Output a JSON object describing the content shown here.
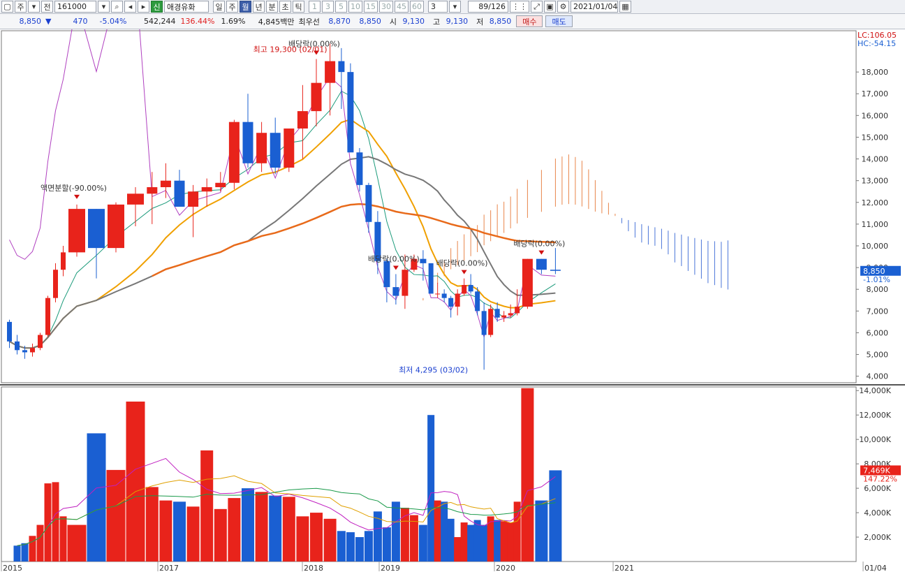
{
  "toolbar": {
    "market_label": "주",
    "prev_label": "전",
    "code": "161000",
    "new_badge": "신",
    "stock_name": "애경유화",
    "period_tabs": [
      "일",
      "주",
      "월",
      "년",
      "분",
      "초",
      "틱"
    ],
    "selected_period": "월",
    "minute_options": [
      "1",
      "3",
      "5",
      "10",
      "15",
      "30",
      "45",
      "60"
    ],
    "interval_value": "3",
    "page_counter": "89/126",
    "date_value": "2021/01/04"
  },
  "quote": {
    "price": "8,850",
    "change_arrow": "▼",
    "change": "470",
    "change_rate": "-5.04%",
    "volume": "542,244",
    "volume_ratio": "136.44%",
    "turnover": "1.69%",
    "amount": "4,845백만",
    "best_label": "최우선",
    "best_ask": "8,870",
    "best_bid": "8,850",
    "open_label": "시",
    "open": "9,130",
    "high_label": "고",
    "high": "9,130",
    "low_label": "저",
    "low": "8,850",
    "buy_label": "매수",
    "sell_label": "매도"
  },
  "colors": {
    "up": "#e8231b",
    "down": "#1a5fd2",
    "accent": "#3c5ea8"
  },
  "chart_data": [
    {
      "type": "candlestick",
      "title": "",
      "xlabel": "",
      "ylabel": "",
      "ylim": [
        3700,
        19900
      ],
      "y_ticks": [
        "4,000",
        "5,000",
        "6,000",
        "7,000",
        "8,000",
        "9,000",
        "10,000",
        "11,000",
        "12,000",
        "13,000",
        "14,000",
        "15,000",
        "16,000",
        "17,000",
        "18,000"
      ],
      "x_ticks": [
        "2015",
        "2017",
        "2018",
        "2019",
        "2020",
        "2021",
        "01/04"
      ],
      "indicator_corner": [
        "LC:106.05",
        "HC:-54.15"
      ],
      "price_tag": "8,850",
      "price_tag_value": 8850,
      "price_tag_change": "-1.01%",
      "annotations": {
        "high_label": "최고 19,300 (02/01)",
        "low_label": "최저 4,295 (03/02)",
        "split_label": "액면분할(-90.00%)",
        "dividend_label": "배당락(0.00%)"
      },
      "candles": [
        [
          6500,
          6600,
          5300,
          5600
        ],
        [
          5600,
          5900,
          5000,
          5200
        ],
        [
          5200,
          5400,
          4800,
          5100
        ],
        [
          5100,
          5500,
          4900,
          5300
        ],
        [
          5300,
          6000,
          5200,
          5900
        ],
        [
          5900,
          7700,
          5800,
          7600
        ],
        [
          7600,
          9200,
          7400,
          8900
        ],
        [
          8900,
          10000,
          8600,
          9700
        ],
        [
          9700,
          11900,
          9500,
          11700
        ],
        [
          11700,
          11700,
          8500,
          9900
        ],
        [
          9900,
          12000,
          9700,
          11900
        ],
        [
          11900,
          12700,
          10900,
          12400
        ],
        [
          12400,
          13400,
          11000,
          12700
        ],
        [
          12700,
          13800,
          12200,
          13000
        ],
        [
          13000,
          13500,
          12100,
          11800
        ],
        [
          11800,
          12800,
          10400,
          12500
        ],
        [
          12500,
          13100,
          11800,
          12700
        ],
        [
          12700,
          13400,
          12500,
          12900
        ],
        [
          12900,
          15800,
          12600,
          15700
        ],
        [
          15700,
          17000,
          13600,
          13800
        ],
        [
          13800,
          15700,
          13400,
          15200
        ],
        [
          15200,
          15900,
          13300,
          13600
        ],
        [
          13600,
          15400,
          13400,
          15400
        ],
        [
          15400,
          17400,
          14000,
          16200
        ],
        [
          16200,
          18600,
          15500,
          17500
        ],
        [
          17500,
          19300,
          16000,
          18500
        ],
        [
          18500,
          19100,
          16300,
          18000
        ],
        [
          18000,
          18400,
          15000,
          14300
        ],
        [
          14300,
          14500,
          12500,
          12800
        ],
        [
          12800,
          12900,
          10600,
          11100
        ],
        [
          11100,
          11600,
          8700,
          9300
        ],
        [
          9300,
          9400,
          7400,
          8100
        ],
        [
          8100,
          8700,
          7300,
          7700
        ],
        [
          7700,
          9600,
          7100,
          8900
        ],
        [
          8900,
          9600,
          8800,
          9400
        ],
        [
          9400,
          9800,
          8400,
          9200
        ],
        [
          9200,
          9200,
          7800,
          7800
        ],
        [
          7800,
          8300,
          7600,
          7800
        ],
        [
          7800,
          8000,
          7400,
          7600
        ],
        [
          7600,
          7700,
          6700,
          7200
        ],
        [
          7200,
          8000,
          6800,
          7800
        ],
        [
          7800,
          8500,
          7700,
          8200
        ],
        [
          8200,
          8700,
          7800,
          7900
        ],
        [
          7900,
          8100,
          6800,
          7000
        ],
        [
          7000,
          7400,
          4300,
          5900
        ],
        [
          5900,
          7300,
          5800,
          7100
        ],
        [
          7100,
          7400,
          6500,
          6700
        ],
        [
          6700,
          7000,
          6500,
          6800
        ],
        [
          6800,
          7300,
          6700,
          6900
        ],
        [
          6900,
          8000,
          6800,
          7200
        ],
        [
          7200,
          9400,
          7100,
          9400
        ],
        [
          9400,
          9400,
          8700,
          8900
        ],
        [
          8900,
          9900,
          8700,
          8850
        ]
      ],
      "dividend_markers": [
        24,
        32,
        41,
        51
      ]
    },
    {
      "type": "bar",
      "title": "",
      "ylim": [
        0,
        14300
      ],
      "y_ticks": [
        "2,000K",
        "4,000K",
        "6,000K",
        "8,000K",
        "10,000K",
        "12,000K",
        "14,000K"
      ],
      "volume_tag": "7,469K",
      "volume_tag_change": "147.22%",
      "values": [
        1300,
        1500,
        2100,
        3000,
        6400,
        6500,
        3700,
        3000,
        10500,
        7500,
        13100,
        6100,
        5000,
        4900,
        4500,
        9100,
        4300,
        5200,
        6000,
        5700,
        5400,
        5300,
        3700,
        4000,
        3500,
        2500,
        2400,
        2000,
        2500,
        4100,
        2800,
        4900,
        4400,
        3800,
        3000,
        12000,
        5000,
        4900,
        3500,
        2000,
        3200,
        3000,
        3400,
        3000,
        3700,
        3400,
        3300,
        3200,
        4900,
        14200,
        5000,
        7469
      ]
    }
  ]
}
